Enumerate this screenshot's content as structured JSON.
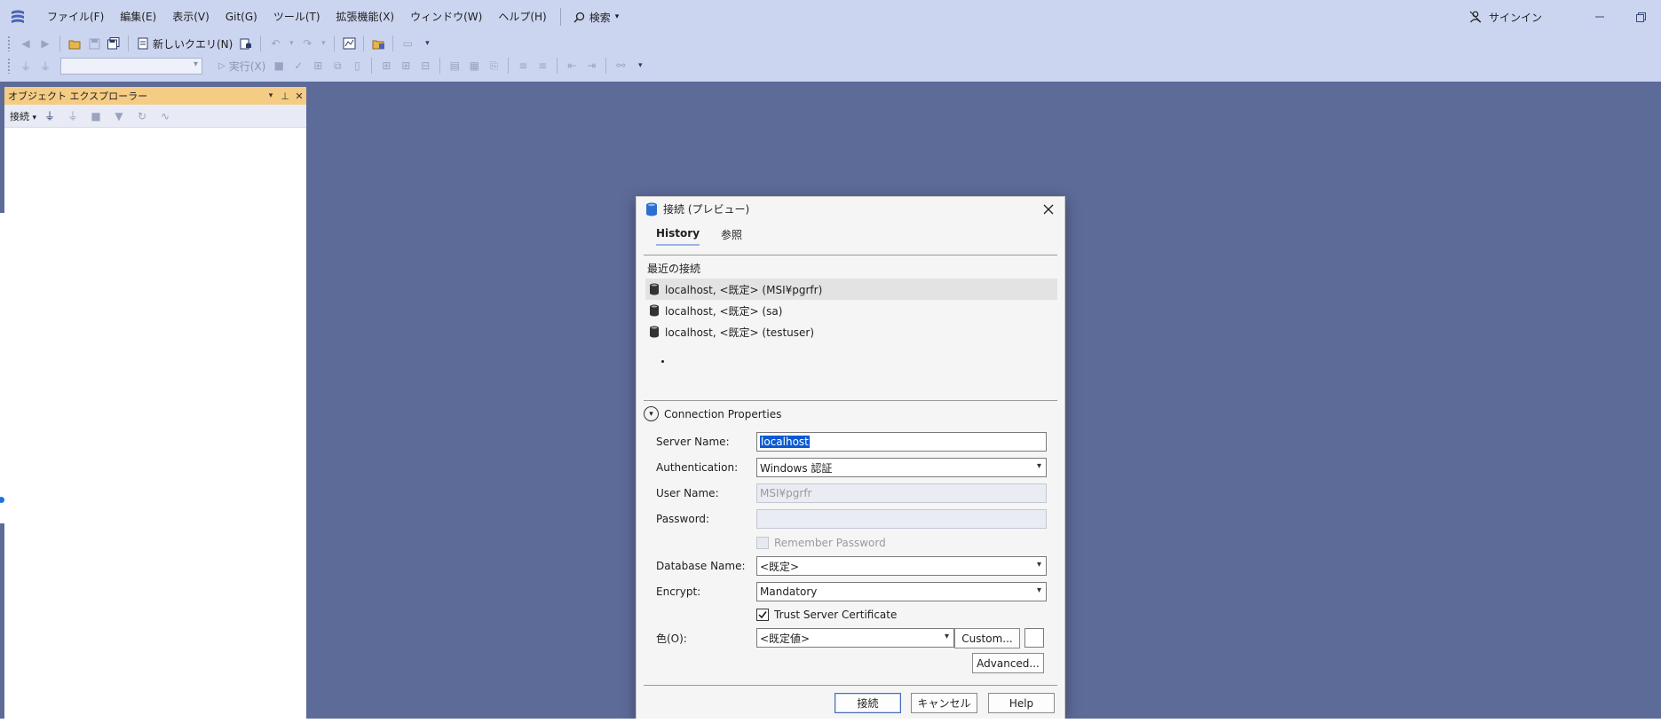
{
  "menubar": {
    "items": [
      "ファイル(F)",
      "編集(E)",
      "表示(V)",
      "Git(G)",
      "ツール(T)",
      "拡張機能(X)",
      "ウィンドウ(W)",
      "ヘルプ(H)"
    ],
    "search_label": "検索",
    "signin_label": "サインイン"
  },
  "toolbar": {
    "new_query_label": "新しいクエリ(N)",
    "execute_label": "実行(X)"
  },
  "object_explorer": {
    "title": "オブジェクト エクスプローラー",
    "connect_label": "接続"
  },
  "dialog": {
    "title": "接続 (プレビュー)",
    "tabs": [
      "History",
      "参照"
    ],
    "recent_label": "最近の接続",
    "recent": [
      "localhost, <既定> (MSI¥pgrfr)",
      "localhost, <既定> (sa)",
      "localhost, <既定> (testuser)"
    ],
    "connection_properties_label": "Connection Properties",
    "fields": {
      "server_name": {
        "label": "Server Name:",
        "value": "localhost"
      },
      "authentication": {
        "label": "Authentication:",
        "value": "Windows 認証"
      },
      "user_name": {
        "label": "User Name:",
        "value": "MSI¥pgrfr"
      },
      "password": {
        "label": "Password:",
        "value": ""
      },
      "remember_password": {
        "label": "Remember Password",
        "checked": false
      },
      "database_name": {
        "label": "Database Name:",
        "value": "<既定>"
      },
      "encrypt": {
        "label": "Encrypt:",
        "value": "Mandatory"
      },
      "trust_server_certificate": {
        "label": "Trust Server Certificate",
        "checked": true
      },
      "color": {
        "label": "色(O):",
        "value": "<既定値>"
      }
    },
    "buttons": {
      "custom": "Custom...",
      "advanced": "Advanced...",
      "connect": "接続",
      "cancel": "キャンセル",
      "help": "Help"
    }
  }
}
